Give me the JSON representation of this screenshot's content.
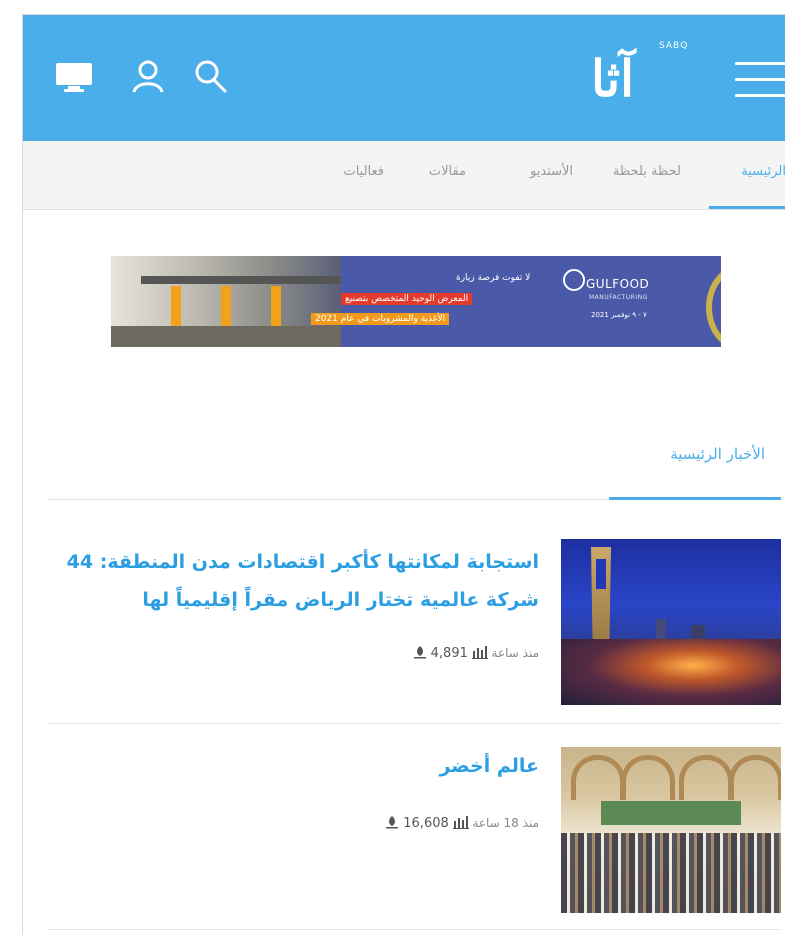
{
  "header": {
    "logo_text": "آثا",
    "logo_small": "SABQ",
    "icons": [
      "tv-icon",
      "user-icon",
      "search-icon",
      "menu-icon"
    ],
    "bg_color": "#4aaeea"
  },
  "nav": {
    "items": [
      {
        "label": "الرئيسية",
        "active": true
      },
      {
        "label": "لحظة بلحظة",
        "active": false
      },
      {
        "label": "الأستديو",
        "active": false
      },
      {
        "label": "مقالات",
        "active": false
      },
      {
        "label": "فعاليات",
        "active": false
      }
    ]
  },
  "ad": {
    "line1": "لا تفوت فرصة زيارة",
    "line2": "المعرض الوحيد المتخصص بتصنيع",
    "line3": "الأغذية والمشروبات في عام 2021",
    "brand": "GULFOOD",
    "brand_sub": "MANUFACTURING",
    "dates": "٧ - ٩ نوفمبر 2021"
  },
  "section": {
    "title": "الأخبار الرئيسية"
  },
  "articles": [
    {
      "title": "استجابة لمكانتها كأكبر اقتصادات مدن المنطقة: 44 شركة عالمية تختار الرياض مقراً إقليمياً لها",
      "time": "منذ ساعة",
      "views": "4,891"
    },
    {
      "title": "عالم أخضر",
      "time": "منذ 18 ساعة",
      "views": "16,608"
    }
  ]
}
